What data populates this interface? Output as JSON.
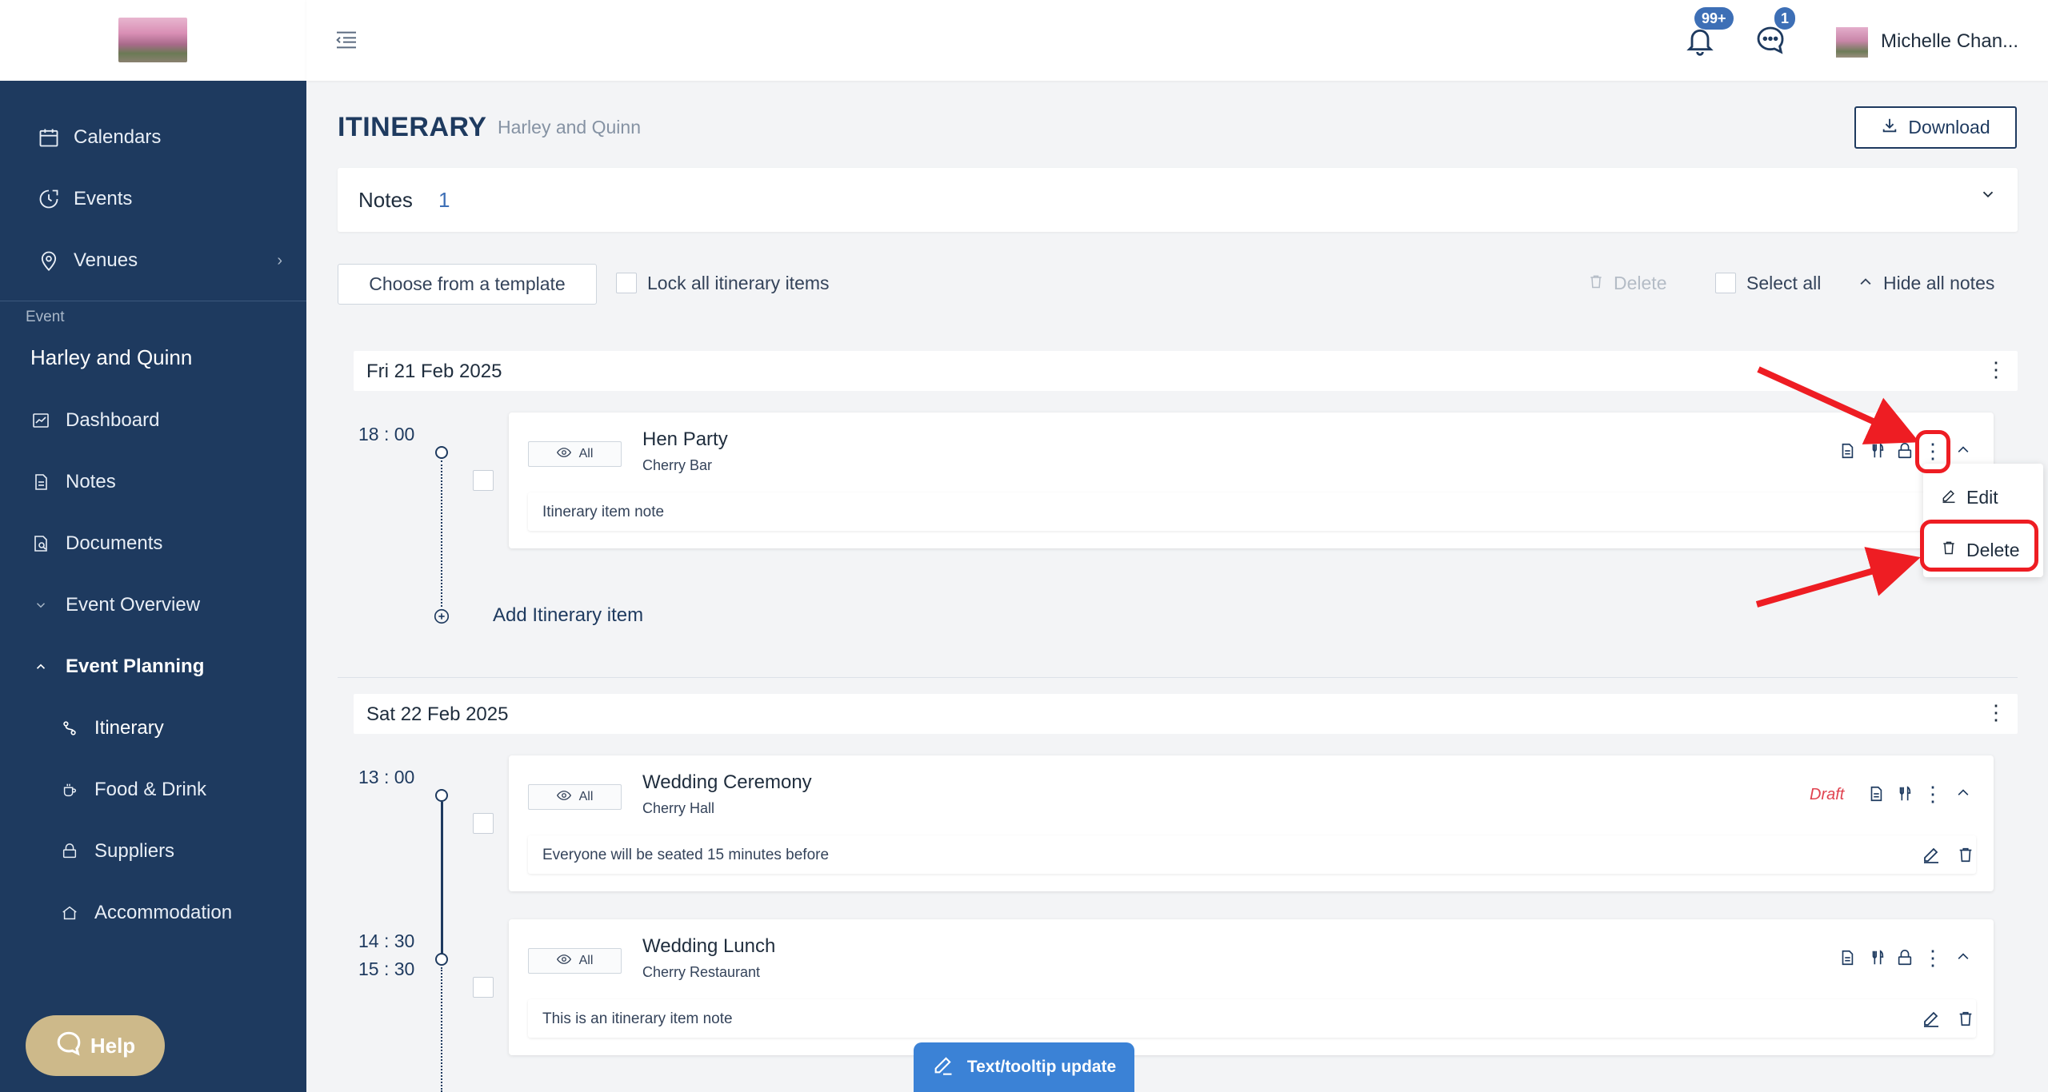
{
  "app": {
    "user_name": "Michelle Chan...",
    "notifications_badge": "99+",
    "messages_badge": "1"
  },
  "sidebar": {
    "items": [
      {
        "label": "Calendars",
        "icon": "calendar-icon"
      },
      {
        "label": "Events",
        "icon": "events-icon"
      },
      {
        "label": "Venues",
        "icon": "location-pin-icon"
      }
    ],
    "event_section_label": "Event",
    "event_name": "Harley and Quinn",
    "event_items": [
      {
        "label": "Dashboard",
        "icon": "dashboard-icon"
      },
      {
        "label": "Notes",
        "icon": "notes-icon"
      },
      {
        "label": "Documents",
        "icon": "documents-icon"
      },
      {
        "label": "Event Overview",
        "icon": "chevron-down-icon"
      },
      {
        "label": "Event Planning",
        "icon": "chevron-up-icon"
      },
      {
        "label": "Itinerary",
        "icon": "itinerary-icon"
      },
      {
        "label": "Food & Drink",
        "icon": "coffee-icon"
      },
      {
        "label": "Suppliers",
        "icon": "suppliers-icon"
      },
      {
        "label": "Accommodation",
        "icon": "home-icon"
      }
    ],
    "help_label": "Help"
  },
  "header": {
    "title": "ITINERARY",
    "subtitle": "Harley and Quinn",
    "download_label": "Download"
  },
  "notes": {
    "label": "Notes",
    "count": "1"
  },
  "toolbar": {
    "template_label": "Choose from a template",
    "lock_label": "Lock all itinerary items",
    "delete_label": "Delete",
    "select_all_label": "Select all",
    "hide_notes_label": "Hide all notes"
  },
  "days": [
    {
      "date": "Fri 21 Feb 2025",
      "items": [
        {
          "time": "18 : 00",
          "visibility": "All",
          "title": "Hen Party",
          "venue": "Cherry Bar",
          "note": "Itinerary item note"
        }
      ],
      "add_label": "Add Itinerary item"
    },
    {
      "date": "Sat 22 Feb 2025",
      "items": [
        {
          "time": "13 : 00",
          "visibility": "All",
          "title": "Wedding Ceremony",
          "venue": "Cherry Hall",
          "status": "Draft",
          "note": "Everyone will be seated 15 minutes before"
        },
        {
          "time": "14 : 30",
          "end_time": "15 : 30",
          "visibility": "All",
          "title": "Wedding Lunch",
          "venue": "Cherry Restaurant",
          "note": "This is an itinerary item note"
        }
      ]
    }
  ],
  "context_menu": {
    "edit_label": "Edit",
    "delete_label": "Delete"
  },
  "tooltip_button": "Text/tooltip update",
  "colors": {
    "sidebar": "#1e3a5f",
    "accent": "#3d6fb6",
    "annotation": "#ee1d23",
    "help": "#cdb98a",
    "draft": "#e0424f"
  }
}
